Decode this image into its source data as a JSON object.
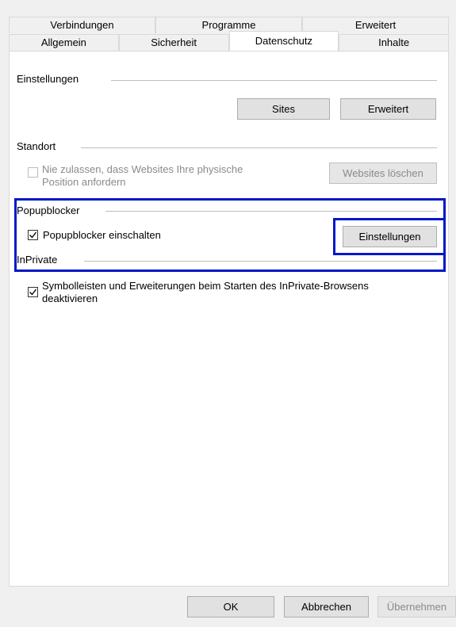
{
  "tabs": {
    "top_row": [
      "Verbindungen",
      "Programme",
      "Erweitert"
    ],
    "bottom_row": [
      "Allgemein",
      "Sicherheit",
      "Datenschutz",
      "Inhalte"
    ],
    "active": "Datenschutz"
  },
  "settings_group": {
    "title": "Einstellungen",
    "sites_button": "Sites",
    "advanced_button": "Erweitert"
  },
  "location_group": {
    "title": "Standort",
    "checkbox_label_line1": "Nie zulassen, dass Websites Ihre physische",
    "checkbox_label_line2": "Position anfordern",
    "checkbox_checked": false,
    "clear_sites_button": "Websites löschen"
  },
  "popup_group": {
    "title": "Popupblocker",
    "checkbox_label": "Popupblocker einschalten",
    "checkbox_checked": true,
    "settings_button": "Einstellungen"
  },
  "inprivate_group": {
    "title": "InPrivate",
    "checkbox_label_line1": "Symbolleisten und Erweiterungen beim Starten des InPrivate-Browsens",
    "checkbox_label_line2": "deaktivieren",
    "checkbox_checked": true
  },
  "footer": {
    "ok_button": "OK",
    "cancel_button": "Abbrechen",
    "apply_button": "Übernehmen"
  },
  "colors": {
    "highlight": "#0018c8"
  }
}
